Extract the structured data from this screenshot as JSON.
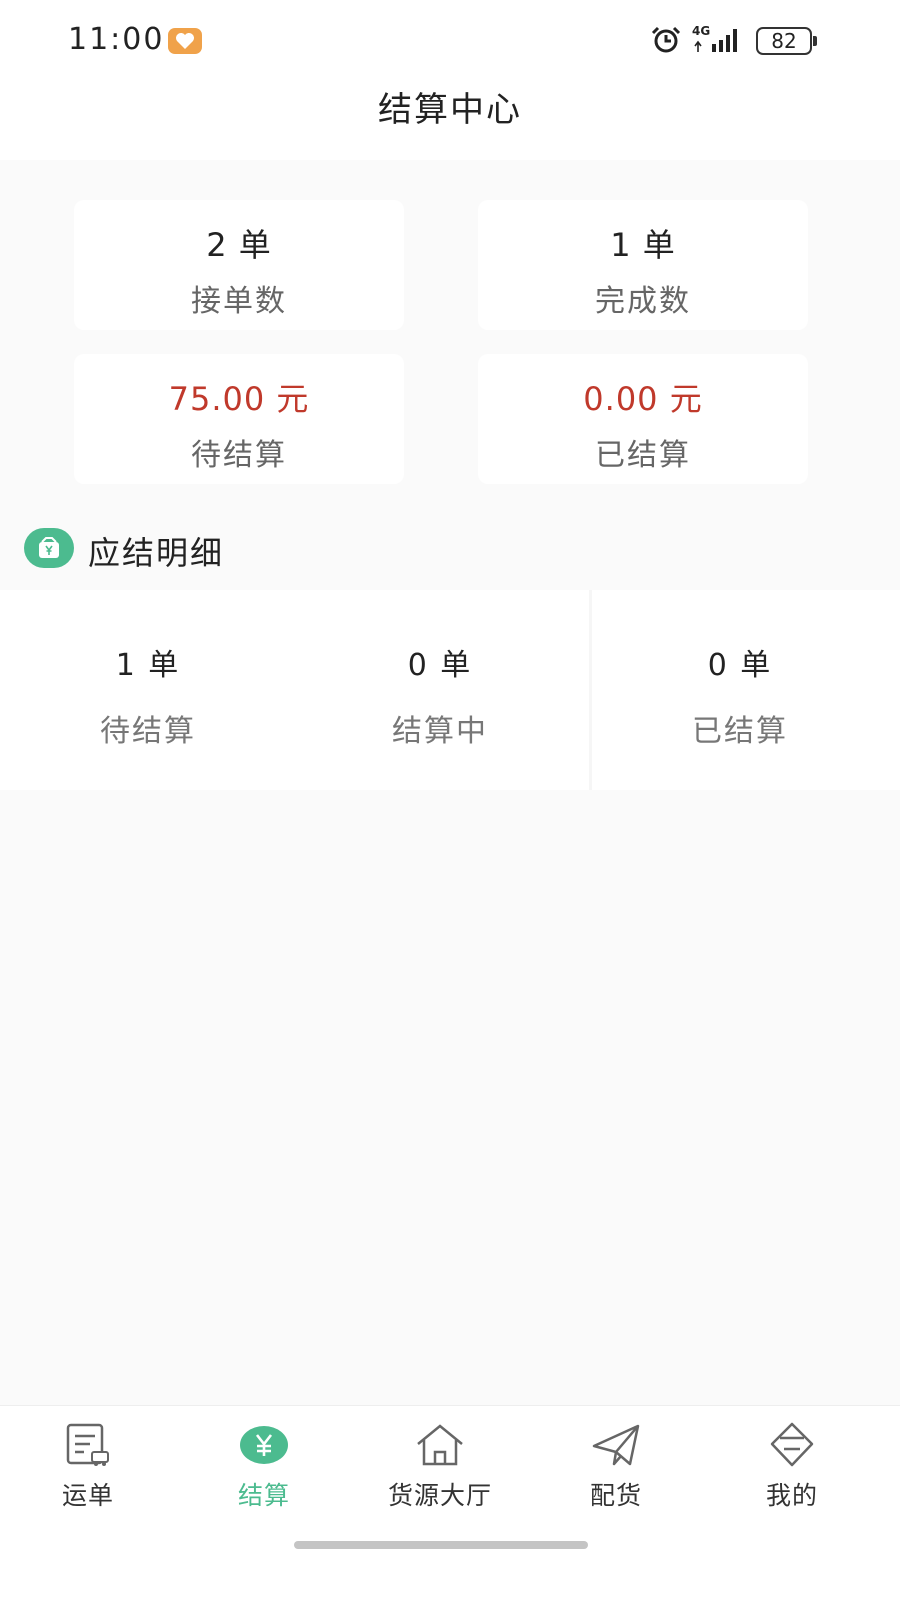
{
  "status_bar": {
    "time": "11:00",
    "network": "4G",
    "battery": "82",
    "icons": [
      "heart-app-icon",
      "alarm-icon",
      "signal-icon",
      "battery-icon"
    ]
  },
  "header": {
    "title": "结算中心"
  },
  "summary_cards": [
    {
      "value": "2 单",
      "label": "接单数"
    },
    {
      "value": "1 单",
      "label": "完成数"
    },
    {
      "value": "75.00 元",
      "label": "待结算"
    },
    {
      "value": "0.00 元",
      "label": "已结算"
    }
  ],
  "section": {
    "title": "应结明细",
    "icon": "wallet-yen-icon"
  },
  "details": [
    {
      "value": "1 单",
      "label": "待结算"
    },
    {
      "value": "0 单",
      "label": "结算中"
    },
    {
      "value": "0 单",
      "label": "已结算"
    }
  ],
  "tabs": [
    {
      "label": "运单",
      "icon": "waybill-icon",
      "active": false
    },
    {
      "label": "结算",
      "icon": "yen-icon",
      "active": true
    },
    {
      "label": "货源大厅",
      "icon": "house-icon",
      "active": false
    },
    {
      "label": "配货",
      "icon": "paper-plane-icon",
      "active": false
    },
    {
      "label": "我的",
      "icon": "profile-diamond-icon",
      "active": false
    }
  ],
  "colors": {
    "accent": "#4cbb8f",
    "money": "#c0392b",
    "background": "#fafafa",
    "card": "#ffffff"
  }
}
